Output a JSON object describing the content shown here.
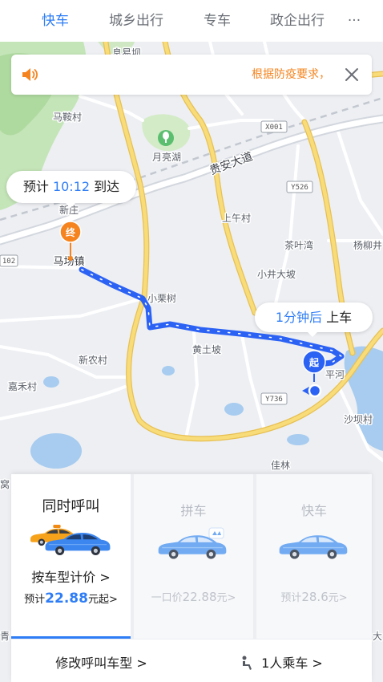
{
  "tabs": [
    {
      "label": "快车",
      "active": true
    },
    {
      "label": "城乡出行",
      "active": false
    },
    {
      "label": "专车",
      "active": false
    },
    {
      "label": "政企出行",
      "active": false
    }
  ],
  "more_label": "···",
  "notice": {
    "text": "根据防疫要求，",
    "icon": "speaker-icon",
    "close_icon": "close-icon"
  },
  "map": {
    "places": [
      "息易坝",
      "马鞍村",
      "月亮湖",
      "上午村",
      "茶叶湾",
      "杨柳井",
      "新庄",
      "马场镇",
      "小栗树",
      "小井大坡",
      "新农村",
      "黄土坡",
      "嘉禾村",
      "平河",
      "沙坝村",
      "佳林",
      "窝",
      "青",
      "大"
    ],
    "road_name": "贵安大道",
    "route_numbers": [
      "X001",
      "Y526",
      "Y736",
      "102"
    ],
    "poi_icon": "park-icon"
  },
  "eta": {
    "prefix": "预计",
    "time": "10:12",
    "suffix": "到达"
  },
  "pickup": {
    "time": "1分钟后",
    "action": "上车"
  },
  "markers": {
    "end": "终",
    "start": "起"
  },
  "ride_options": [
    {
      "title": "同时呼叫",
      "selected": true,
      "subtitle": "按车型计价 >",
      "price_prefix": "预计",
      "price": "22.88",
      "price_suffix": "元起>",
      "image": "taxi-and-car-icon"
    },
    {
      "title": "拼车",
      "selected": false,
      "price_prefix": "一口价",
      "price": "22.88",
      "price_suffix": "元>",
      "image": "carpool-car-icon"
    },
    {
      "title": "快车",
      "selected": false,
      "price_prefix": "预计",
      "price": "28.6",
      "price_suffix": "元>",
      "image": "car-icon"
    }
  ],
  "footer": {
    "change_type": "修改呼叫车型 >",
    "passengers": "1人乘车 >",
    "seat_icon": "seat-icon"
  },
  "colors": {
    "accent": "#2e7df6",
    "warning": "#f5841f",
    "route": "#2c62f4",
    "inactive_text": "#bfc3ca"
  }
}
